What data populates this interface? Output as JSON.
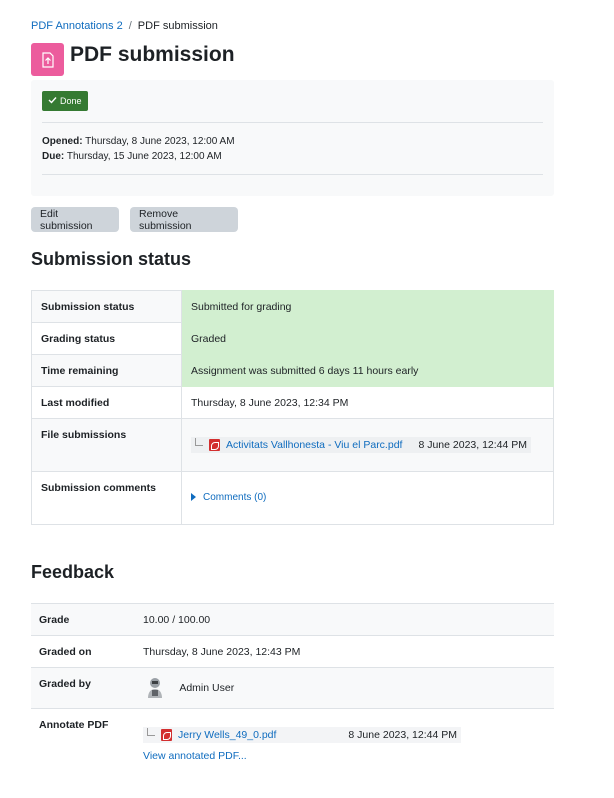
{
  "breadcrumb": {
    "parent": "PDF Annotations 2",
    "separator": "/",
    "current": "PDF submission"
  },
  "header": {
    "title": "PDF submission",
    "icon": "document-upload-icon",
    "icon_color": "#ec5c9d"
  },
  "activity": {
    "done_label": "Done",
    "opened_label": "Opened:",
    "opened_value": "Thursday, 8 June 2023, 12:00 AM",
    "due_label": "Due:",
    "due_value": "Thursday, 15 June 2023, 12:00 AM"
  },
  "buttons": {
    "edit": "Edit submission",
    "remove": "Remove submission"
  },
  "submission_status": {
    "heading": "Submission status",
    "rows": [
      {
        "label": "Submission status",
        "value": "Submitted for grading"
      },
      {
        "label": "Grading status",
        "value": "Graded"
      },
      {
        "label": "Time remaining",
        "value": "Assignment was submitted 6 days 11 hours early"
      },
      {
        "label": "Last modified",
        "value": "Thursday, 8 June 2023, 12:34 PM"
      },
      {
        "label": "File submissions",
        "file_name": "Activitats Vallhonesta - Viu el Parc.pdf",
        "file_date": "8 June 2023, 12:44 PM"
      },
      {
        "label": "Submission comments",
        "value": "Comments (0)"
      }
    ]
  },
  "feedback": {
    "heading": "Feedback",
    "rows": [
      {
        "label": "Grade",
        "value": "10.00 / 100.00"
      },
      {
        "label": "Graded on",
        "value": "Thursday, 8 June 2023, 12:43 PM"
      },
      {
        "label": "Graded by",
        "value": "Admin User"
      },
      {
        "label": "Annotate PDF",
        "file_name": "Jerry Wells_49_0.pdf",
        "file_date": "8 June 2023, 12:44 PM",
        "link": "View annotated PDF..."
      }
    ]
  },
  "colors": {
    "success": "#357a32",
    "graded_bg": "#d2efd0",
    "link": "#0f6cbf",
    "button_bg": "#ced4da"
  }
}
